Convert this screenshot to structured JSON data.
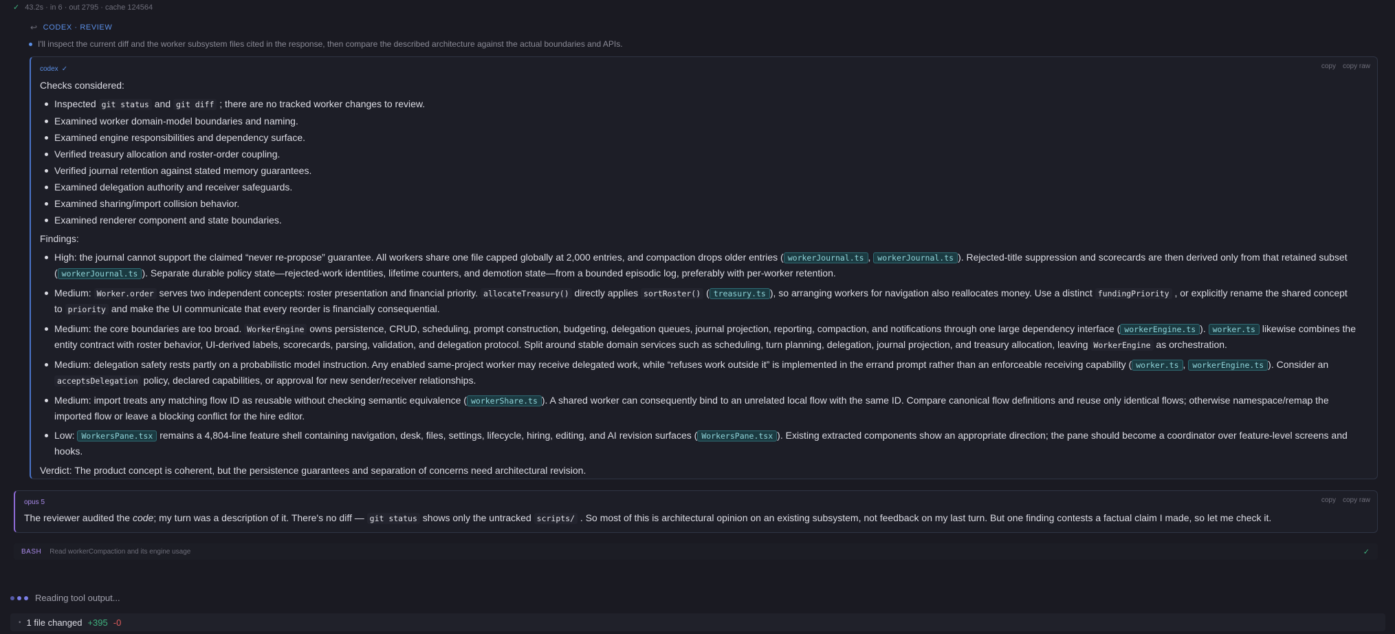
{
  "top_status": {
    "check": "✓",
    "text": "43.2s · in 6 · out 2795 · cache 124564"
  },
  "review_header": {
    "arrow": "↩",
    "label": "CODEX · REVIEW"
  },
  "intent": "I'll inspect the current diff and the worker subsystem files cited in the response, then compare the described architecture against the actual boundaries and APIs.",
  "codex_card": {
    "agent": "codex",
    "agent_check": "✓",
    "actions": [
      "copy",
      "copy raw"
    ],
    "checks_heading": "Checks considered:",
    "checks": [
      {
        "before": "Inspected ",
        "code1": "git status",
        "mid": " and ",
        "code2": "git diff",
        "after": " ; there are no tracked worker changes to review."
      },
      {
        "text": "Examined worker domain-model boundaries and naming."
      },
      {
        "text": "Examined engine responsibilities and dependency surface."
      },
      {
        "text": "Verified treasury allocation and roster-order coupling."
      },
      {
        "text": "Verified journal retention against stated memory guarantees."
      },
      {
        "text": "Examined delegation authority and receiver safeguards."
      },
      {
        "text": "Examined sharing/import collision behavior."
      },
      {
        "text": "Examined renderer component and state boundaries."
      }
    ],
    "findings_heading": "Findings:",
    "findings": {
      "f1": {
        "a": "High: the journal cannot support the claimed “never re-propose” guarantee. All workers share one file capped globally at 2,000 entries, and compaction drops older entries (",
        "p1": "workerJournal.ts",
        "b": ", ",
        "p2": "workerJournal.ts",
        "c": "). Rejected-title suppression and scorecards are then derived only from that retained subset (",
        "p3": "workerJournal.ts",
        "d": "). Separate durable policy state—rejected-work identities, lifetime counters, and demotion state—from a bounded episodic log, preferably with per-worker retention."
      },
      "f2": {
        "a": "Medium: ",
        "c1": "Worker.order",
        "b": " serves two independent concepts: roster presentation and financial priority. ",
        "c2": "allocateTreasury()",
        "c": " directly applies ",
        "c3": "sortRoster()",
        "d": " (",
        "p1": "treasury.ts",
        "e": "), so arranging workers for navigation also reallocates money. Use a distinct ",
        "c4": "fundingPriority",
        "f": " , or explicitly rename the shared concept to ",
        "c5": "priority",
        "g": " and make the UI communicate that every reorder is financially consequential."
      },
      "f3": {
        "a": "Medium: the core boundaries are too broad. ",
        "c1": "WorkerEngine",
        "b": " owns persistence, CRUD, scheduling, prompt construction, budgeting, delegation queues, journal projection, reporting, compaction, and notifications through one large dependency interface (",
        "p1": "workerEngine.ts",
        "c": "). ",
        "p2": "worker.ts",
        "d": " likewise combines the entity contract with roster behavior, UI-derived labels, scorecards, parsing, validation, and delegation protocol. Split around stable domain services such as scheduling, turn planning, delegation, journal projection, and treasury allocation, leaving ",
        "c2": "WorkerEngine",
        "e": " as orchestration."
      },
      "f4": {
        "a": "Medium: delegation safety rests partly on a probabilistic model instruction. Any enabled same-project worker may receive delegated work, while “refuses work outside it” is implemented in the errand prompt rather than an enforceable receiving capability (",
        "p1": "worker.ts",
        "b": ", ",
        "p2": "workerEngine.ts",
        "c": "). Consider an ",
        "c1": "acceptsDelegation",
        "d": " policy, declared capabilities, or approval for new sender/receiver relationships."
      },
      "f5": {
        "a": "Medium: import treats any matching flow ID as reusable without checking semantic equivalence (",
        "p1": "workerShare.ts",
        "b": "). A shared worker can consequently bind to an unrelated local flow with the same ID. Compare canonical flow definitions and reuse only identical flows; otherwise namespace/remap the imported flow or leave a blocking conflict for the hire editor."
      },
      "f6": {
        "a": "Low: ",
        "p1": "WorkersPane.tsx",
        "b": " remains a 4,804-line feature shell containing navigation, desk, files, settings, lifecycle, hiring, editing, and AI revision surfaces (",
        "p2": "WorkersPane.tsx",
        "c": "). Existing extracted components show an appropriate direction; the pane should become a coordinator over feature-level screens and hooks."
      }
    },
    "verdict": "Verdict: The product concept is coherent, but the persistence guarantees and separation of concerns need architectural revision."
  },
  "opus_card": {
    "agent": "opus 5",
    "actions": [
      "copy",
      "copy raw"
    ],
    "t1": "The reviewer audited the ",
    "em": "code",
    "t2": "; my turn was a description of it. There's no diff — ",
    "c1": "git status",
    "t3": " shows only the untracked ",
    "c2": "scripts/",
    "t4": " . So most of this is architectural opinion on an existing subsystem, not feedback on my last turn. But one finding contests a factual claim I made, so let me check it."
  },
  "bash_row": {
    "tag": "BASH",
    "desc": "Read workerCompaction and its engine usage",
    "ok": "✓"
  },
  "reading": "Reading tool output...",
  "file_bar": {
    "bullet": "•",
    "label": "1 file changed",
    "additions": "+395",
    "deletions": "-0"
  },
  "colors": {
    "accent_blue": "#5b8fe6",
    "accent_purple": "#a889e8",
    "ok_green": "#3fb37f",
    "del_red": "#e05c5c",
    "path_pill": "#8fd3d8"
  }
}
